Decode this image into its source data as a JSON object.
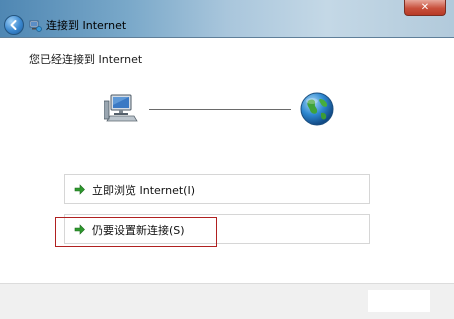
{
  "window": {
    "title": "连接到 Internet",
    "back_icon": "back-arrow-icon",
    "title_icon": "network-icon",
    "close_icon": "close-icon",
    "close_glyph": "✕"
  },
  "main": {
    "heading": "您已经连接到 Internet",
    "status_diagram": {
      "left_icon": "computer-icon",
      "right_icon": "globe-icon"
    },
    "options": [
      {
        "label": "立即浏览 Internet(I)",
        "icon": "green-arrow-icon"
      },
      {
        "label": "仍要设置新连接(S)",
        "icon": "green-arrow-icon"
      }
    ],
    "highlight_color": "#b02020"
  }
}
